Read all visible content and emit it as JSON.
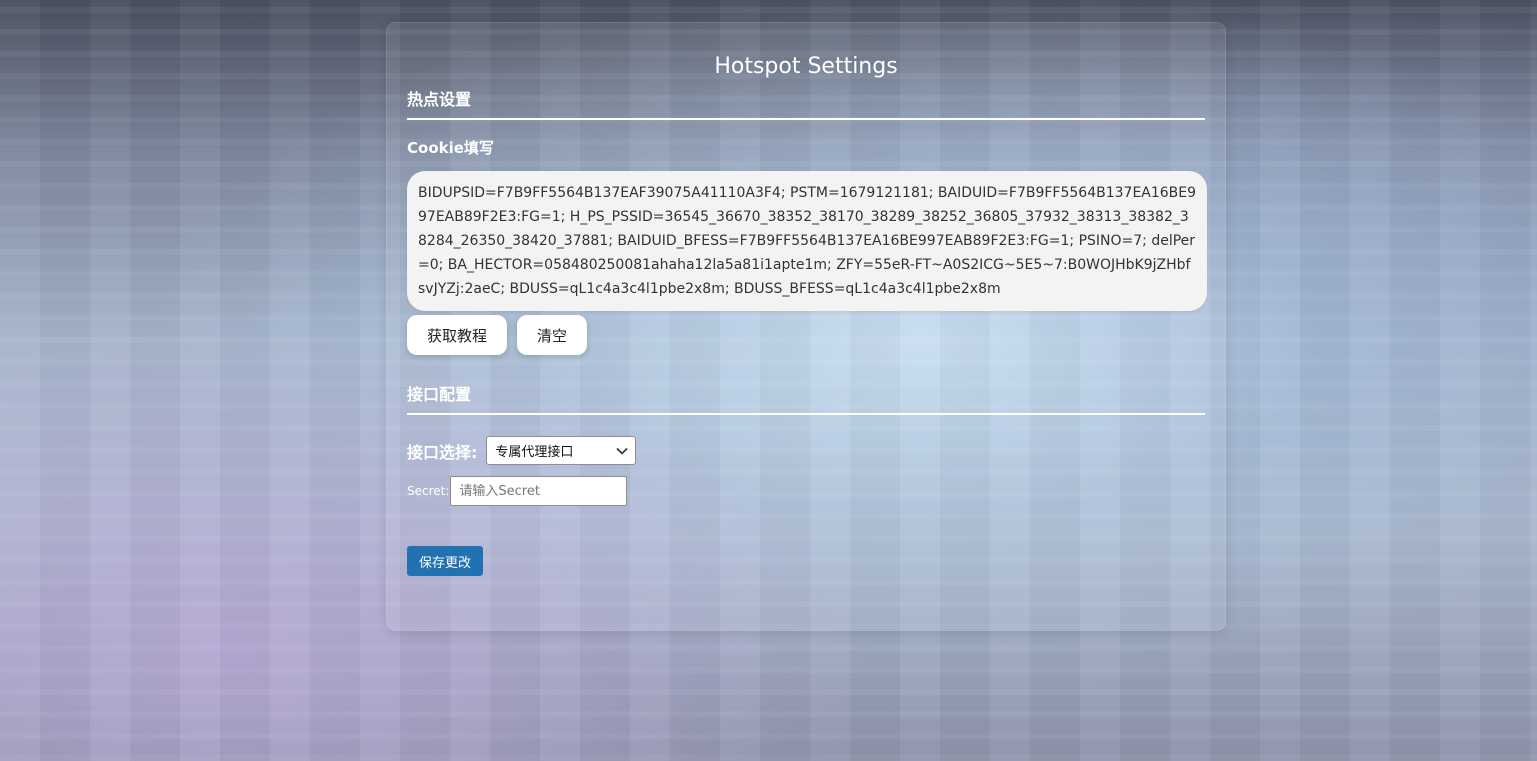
{
  "page": {
    "title": "Hotspot Settings"
  },
  "hotspot_section": {
    "heading": "热点设置",
    "cookie_label": "Cookie填写",
    "cookie_value": "BIDUPSID=F7B9FF5564B137EAF39075A41110A3F4; PSTM=1679121181; BAIDUID=F7B9FF5564B137EA16BE997EAB89F2E3:FG=1; H_PS_PSSID=36545_36670_38352_38170_38289_38252_36805_37932_38313_38382_38284_26350_38420_37881; BAIDUID_BFESS=F7B9FF5564B137EA16BE997EAB89F2E3:FG=1; PSINO=7; delPer=0; BA_HECTOR=058480250081ahaha12la5a81i1apte1m; ZFY=55eR-FT~A0S2ICG~5E5~7:B0WOJHbK9jZHbfsvJYZj:2aeC; BDUSS=qL1c4a3c4l1pbe2x8m; BDUSS_BFESS=qL1c4a3c4l1pbe2x8m",
    "tutorial_button": "获取教程",
    "clear_button": "清空"
  },
  "api_section": {
    "heading": "接口配置",
    "select_label": "接口选择:",
    "select_value": "专属代理接口",
    "secret_label": "Secret:",
    "secret_placeholder": "请输入Secret",
    "secret_value": ""
  },
  "actions": {
    "save_button": "保存更改"
  },
  "colors": {
    "save_button_bg": "#2271b1",
    "cookie_box_bg": "#f3f3f3",
    "text_on_panel": "#ffffff"
  },
  "icons": {
    "select_arrow": "chevron-down-icon"
  }
}
